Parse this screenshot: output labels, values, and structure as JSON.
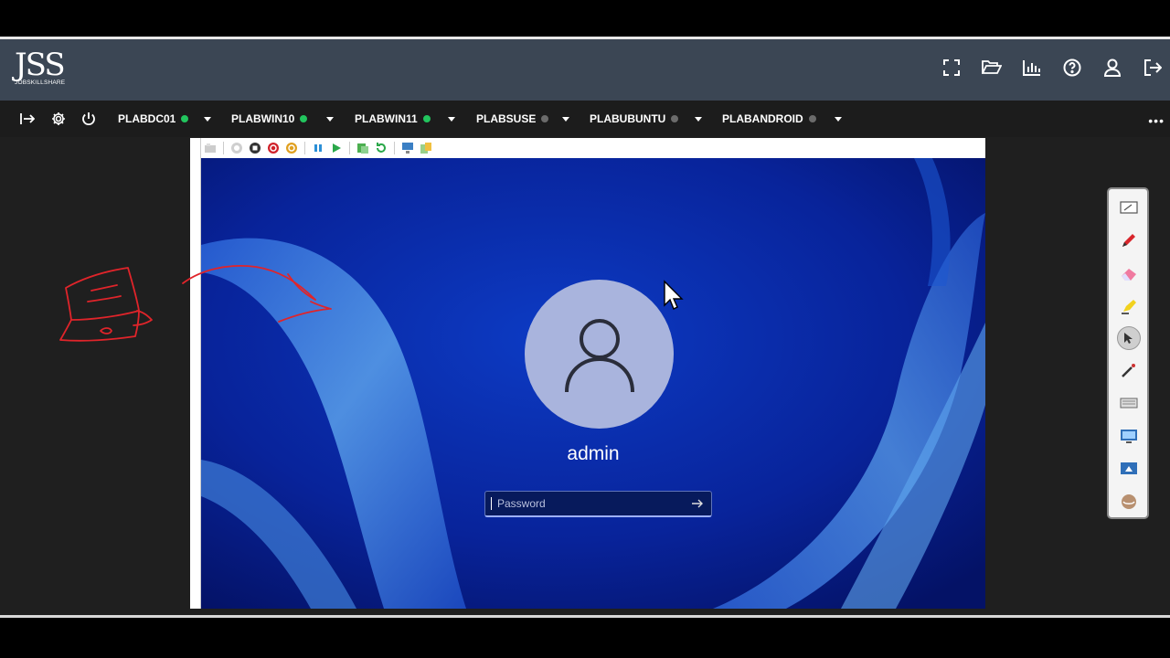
{
  "header": {
    "logo_text": "JSS",
    "logo_subtext": "JOBSKILLSHARE",
    "icons": [
      "fullscreen-icon",
      "folder-open-icon",
      "bar-chart-icon",
      "help-icon",
      "user-icon",
      "logout-icon"
    ]
  },
  "toolbar": {
    "icons": [
      "sidebar-toggle-icon",
      "settings-icon",
      "power-icon"
    ],
    "tabs": [
      {
        "label": "PLABDC01",
        "status": "online",
        "status_color": "#22c55e"
      },
      {
        "label": "PLABWIN10",
        "status": "online",
        "status_color": "#22c55e"
      },
      {
        "label": "PLABWIN11",
        "status": "online",
        "status_color": "#22c55e"
      },
      {
        "label": "PLABSUSE",
        "status": "offline",
        "status_color": "#6b6b6b"
      },
      {
        "label": "PLABUBUNTU",
        "status": "offline",
        "status_color": "#6b6b6b"
      },
      {
        "label": "PLABANDROID",
        "status": "offline",
        "status_color": "#6b6b6b"
      }
    ],
    "more_icon": "more-horizontal-icon"
  },
  "vm": {
    "controls": [
      "ctrl-alt-del-icon",
      "reset-icon",
      "stop-icon",
      "shutdown-icon",
      "save-state-icon",
      "pause-icon",
      "play-icon",
      "snapshot-icon",
      "revert-icon",
      "connect-icon",
      "enhanced-session-icon"
    ],
    "login": {
      "username": "admin",
      "password_placeholder": "Password",
      "submit_icon": "arrow-right-icon"
    }
  },
  "annotation_palette": {
    "tools": [
      "whiteboard-icon",
      "pen-icon",
      "eraser-icon",
      "highlighter-icon",
      "pointer-icon",
      "laser-pen-icon",
      "keyboard-icon",
      "screen-capture-icon",
      "screen-share-icon",
      "hide-icon"
    ]
  },
  "colors": {
    "header_bg": "#3b4654",
    "toolbar_bg": "#1c1c1c",
    "desktop_blue": "#0a2a9a",
    "annotation_red": "#e0242a"
  }
}
